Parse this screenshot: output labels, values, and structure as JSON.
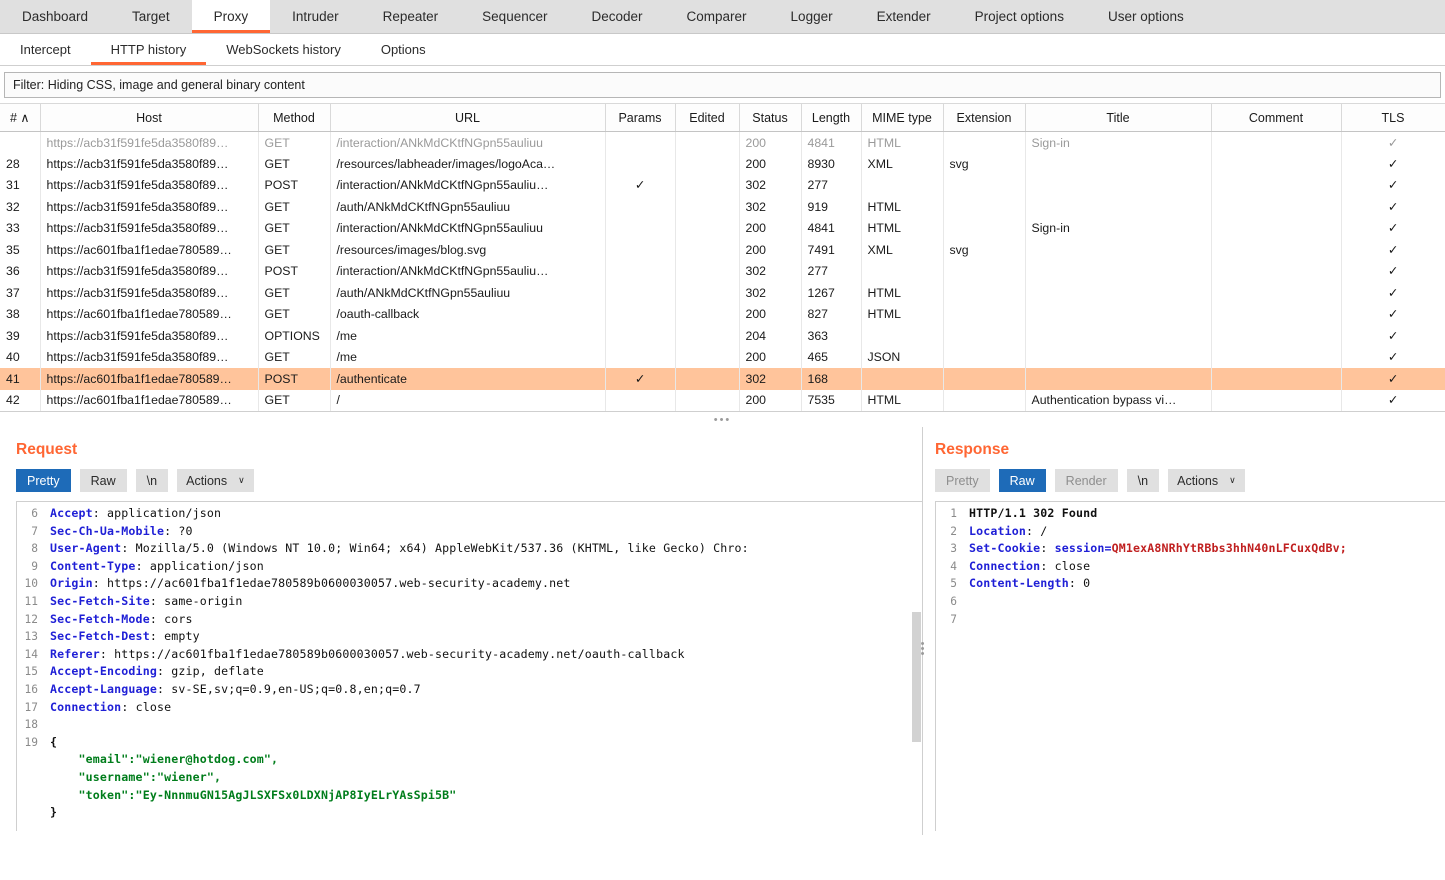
{
  "main_tabs": [
    {
      "label": "Dashboard",
      "active": false
    },
    {
      "label": "Target",
      "active": false
    },
    {
      "label": "Proxy",
      "active": true
    },
    {
      "label": "Intruder",
      "active": false
    },
    {
      "label": "Repeater",
      "active": false
    },
    {
      "label": "Sequencer",
      "active": false
    },
    {
      "label": "Decoder",
      "active": false
    },
    {
      "label": "Comparer",
      "active": false
    },
    {
      "label": "Logger",
      "active": false
    },
    {
      "label": "Extender",
      "active": false
    },
    {
      "label": "Project options",
      "active": false
    },
    {
      "label": "User options",
      "active": false
    }
  ],
  "sub_tabs": [
    {
      "label": "Intercept",
      "active": false
    },
    {
      "label": "HTTP history",
      "active": true
    },
    {
      "label": "WebSockets history",
      "active": false
    },
    {
      "label": "Options",
      "active": false
    }
  ],
  "filter": {
    "text": "Filter: Hiding CSS, image and general binary content"
  },
  "table": {
    "columns": [
      "#",
      "Host",
      "Method",
      "URL",
      "Params",
      "Edited",
      "Status",
      "Length",
      "MIME type",
      "Extension",
      "Title",
      "Comment",
      "TLS"
    ],
    "sort_indicator": "∧",
    "check_glyph": "✓",
    "partial_row": {
      "num": "",
      "host": "https://acb31f591fe5da3580f89…",
      "method": "GET",
      "url": "/interaction/ANkMdCKtfNGpn55auliuu",
      "params": "",
      "edited": "",
      "status": "200",
      "length": "4841",
      "mime": "HTML",
      "extension": "",
      "title": "Sign-in",
      "comment": "",
      "tls": "✓"
    },
    "rows": [
      {
        "num": "28",
        "host": "https://acb31f591fe5da3580f89…",
        "method": "GET",
        "url": "/resources/labheader/images/logoAca…",
        "params": "",
        "edited": "",
        "status": "200",
        "length": "8930",
        "mime": "XML",
        "extension": "svg",
        "title": "",
        "comment": "",
        "tls": "✓",
        "selected": false
      },
      {
        "num": "31",
        "host": "https://acb31f591fe5da3580f89…",
        "method": "POST",
        "url": "/interaction/ANkMdCKtfNGpn55auliu…",
        "params": "✓",
        "edited": "",
        "status": "302",
        "length": "277",
        "mime": "",
        "extension": "",
        "title": "",
        "comment": "",
        "tls": "✓",
        "selected": false
      },
      {
        "num": "32",
        "host": "https://acb31f591fe5da3580f89…",
        "method": "GET",
        "url": "/auth/ANkMdCKtfNGpn55auliuu",
        "params": "",
        "edited": "",
        "status": "302",
        "length": "919",
        "mime": "HTML",
        "extension": "",
        "title": "",
        "comment": "",
        "tls": "✓",
        "selected": false
      },
      {
        "num": "33",
        "host": "https://acb31f591fe5da3580f89…",
        "method": "GET",
        "url": "/interaction/ANkMdCKtfNGpn55auliuu",
        "params": "",
        "edited": "",
        "status": "200",
        "length": "4841",
        "mime": "HTML",
        "extension": "",
        "title": "Sign-in",
        "comment": "",
        "tls": "✓",
        "selected": false
      },
      {
        "num": "35",
        "host": "https://ac601fba1f1edae780589…",
        "method": "GET",
        "url": "/resources/images/blog.svg",
        "params": "",
        "edited": "",
        "status": "200",
        "length": "7491",
        "mime": "XML",
        "extension": "svg",
        "title": "",
        "comment": "",
        "tls": "✓",
        "selected": false
      },
      {
        "num": "36",
        "host": "https://acb31f591fe5da3580f89…",
        "method": "POST",
        "url": "/interaction/ANkMdCKtfNGpn55auliu…",
        "params": "",
        "edited": "",
        "status": "302",
        "length": "277",
        "mime": "",
        "extension": "",
        "title": "",
        "comment": "",
        "tls": "✓",
        "selected": false
      },
      {
        "num": "37",
        "host": "https://acb31f591fe5da3580f89…",
        "method": "GET",
        "url": "/auth/ANkMdCKtfNGpn55auliuu",
        "params": "",
        "edited": "",
        "status": "302",
        "length": "1267",
        "mime": "HTML",
        "extension": "",
        "title": "",
        "comment": "",
        "tls": "✓",
        "selected": false
      },
      {
        "num": "38",
        "host": "https://ac601fba1f1edae780589…",
        "method": "GET",
        "url": "/oauth-callback",
        "params": "",
        "edited": "",
        "status": "200",
        "length": "827",
        "mime": "HTML",
        "extension": "",
        "title": "",
        "comment": "",
        "tls": "✓",
        "selected": false
      },
      {
        "num": "39",
        "host": "https://acb31f591fe5da3580f89…",
        "method": "OPTIONS",
        "url": "/me",
        "params": "",
        "edited": "",
        "status": "204",
        "length": "363",
        "mime": "",
        "extension": "",
        "title": "",
        "comment": "",
        "tls": "✓",
        "selected": false
      },
      {
        "num": "40",
        "host": "https://acb31f591fe5da3580f89…",
        "method": "GET",
        "url": "/me",
        "params": "",
        "edited": "",
        "status": "200",
        "length": "465",
        "mime": "JSON",
        "extension": "",
        "title": "",
        "comment": "",
        "tls": "✓",
        "selected": false
      },
      {
        "num": "41",
        "host": "https://ac601fba1f1edae780589…",
        "method": "POST",
        "url": "/authenticate",
        "params": "✓",
        "edited": "",
        "status": "302",
        "length": "168",
        "mime": "",
        "extension": "",
        "title": "",
        "comment": "",
        "tls": "✓",
        "selected": true
      },
      {
        "num": "42",
        "host": "https://ac601fba1f1edae780589…",
        "method": "GET",
        "url": "/",
        "params": "",
        "edited": "",
        "status": "200",
        "length": "7535",
        "mime": "HTML",
        "extension": "",
        "title": "Authentication bypass vi…",
        "comment": "",
        "tls": "✓",
        "selected": false
      }
    ]
  },
  "request": {
    "title": "Request",
    "buttons": [
      {
        "label": "Pretty",
        "state": "on"
      },
      {
        "label": "Raw",
        "state": "off"
      },
      {
        "label": "\\n",
        "state": "off"
      },
      {
        "label": "Actions",
        "state": "off",
        "caret": "∨"
      }
    ],
    "first_line_number": 6,
    "lines": [
      {
        "n": 6,
        "key": "Accept",
        "value": " application/json"
      },
      {
        "n": 7,
        "key": "Sec-Ch-Ua-Mobile",
        "value": " ?0"
      },
      {
        "n": 8,
        "key": "User-Agent",
        "value": " Mozilla/5.0 (Windows NT 10.0; Win64; x64) AppleWebKit/537.36 (KHTML, like Gecko) Chro:"
      },
      {
        "n": 9,
        "key": "Content-Type",
        "value": " application/json"
      },
      {
        "n": 10,
        "key": "Origin",
        "value": " https://ac601fba1f1edae780589b0600030057.web-security-academy.net"
      },
      {
        "n": 11,
        "key": "Sec-Fetch-Site",
        "value": " same-origin"
      },
      {
        "n": 12,
        "key": "Sec-Fetch-Mode",
        "value": " cors"
      },
      {
        "n": 13,
        "key": "Sec-Fetch-Dest",
        "value": " empty"
      },
      {
        "n": 14,
        "key": "Referer",
        "value": " https://ac601fba1f1edae780589b0600030057.web-security-academy.net/oauth-callback"
      },
      {
        "n": 15,
        "key": "Accept-Encoding",
        "value": " gzip, deflate"
      },
      {
        "n": 16,
        "key": "Accept-Language",
        "value": " sv-SE,sv;q=0.9,en-US;q=0.8,en;q=0.7"
      },
      {
        "n": 17,
        "key": "Connection",
        "value": " close"
      },
      {
        "n": 18,
        "key": "",
        "value": ""
      },
      {
        "n": 19,
        "key": "",
        "value": "",
        "body": "{"
      }
    ],
    "body_lines": [
      "    \"email\":\"wiener@hotdog.com\",",
      "    \"username\":\"wiener\",",
      "    \"token\":\"Ey-NnnmuGN15AgJLSXFSx0LDXNjAP8IyELrYAsSpi5B\"",
      "}"
    ]
  },
  "response": {
    "title": "Response",
    "buttons": [
      {
        "label": "Pretty",
        "state": "dim"
      },
      {
        "label": "Raw",
        "state": "on"
      },
      {
        "label": "Render",
        "state": "dim"
      },
      {
        "label": "\\n",
        "state": "off"
      },
      {
        "label": "Actions",
        "state": "off",
        "caret": "∨"
      }
    ],
    "lines": [
      {
        "n": 1,
        "status_line": "HTTP/1.1 302 Found"
      },
      {
        "n": 2,
        "key": "Location",
        "value": " /"
      },
      {
        "n": 3,
        "key": "Set-Cookie",
        "cookie_name": " session=",
        "cookie_value": "QM1exA8NRhYtRBbs3hhN40nLFCuxQdBv;"
      },
      {
        "n": 4,
        "key": "Connection",
        "value": " close"
      },
      {
        "n": 5,
        "key": "Content-Length",
        "value": " 0"
      },
      {
        "n": 6,
        "key": "",
        "value": ""
      },
      {
        "n": 7,
        "key": "",
        "value": ""
      }
    ]
  },
  "colors": {
    "accent": "#ff6633",
    "selection": "#ffc49b",
    "button_active": "#1e6bb8",
    "header_key": "#1f1fd6",
    "string_green": "#007d1b",
    "cookie_red": "#c02020"
  }
}
